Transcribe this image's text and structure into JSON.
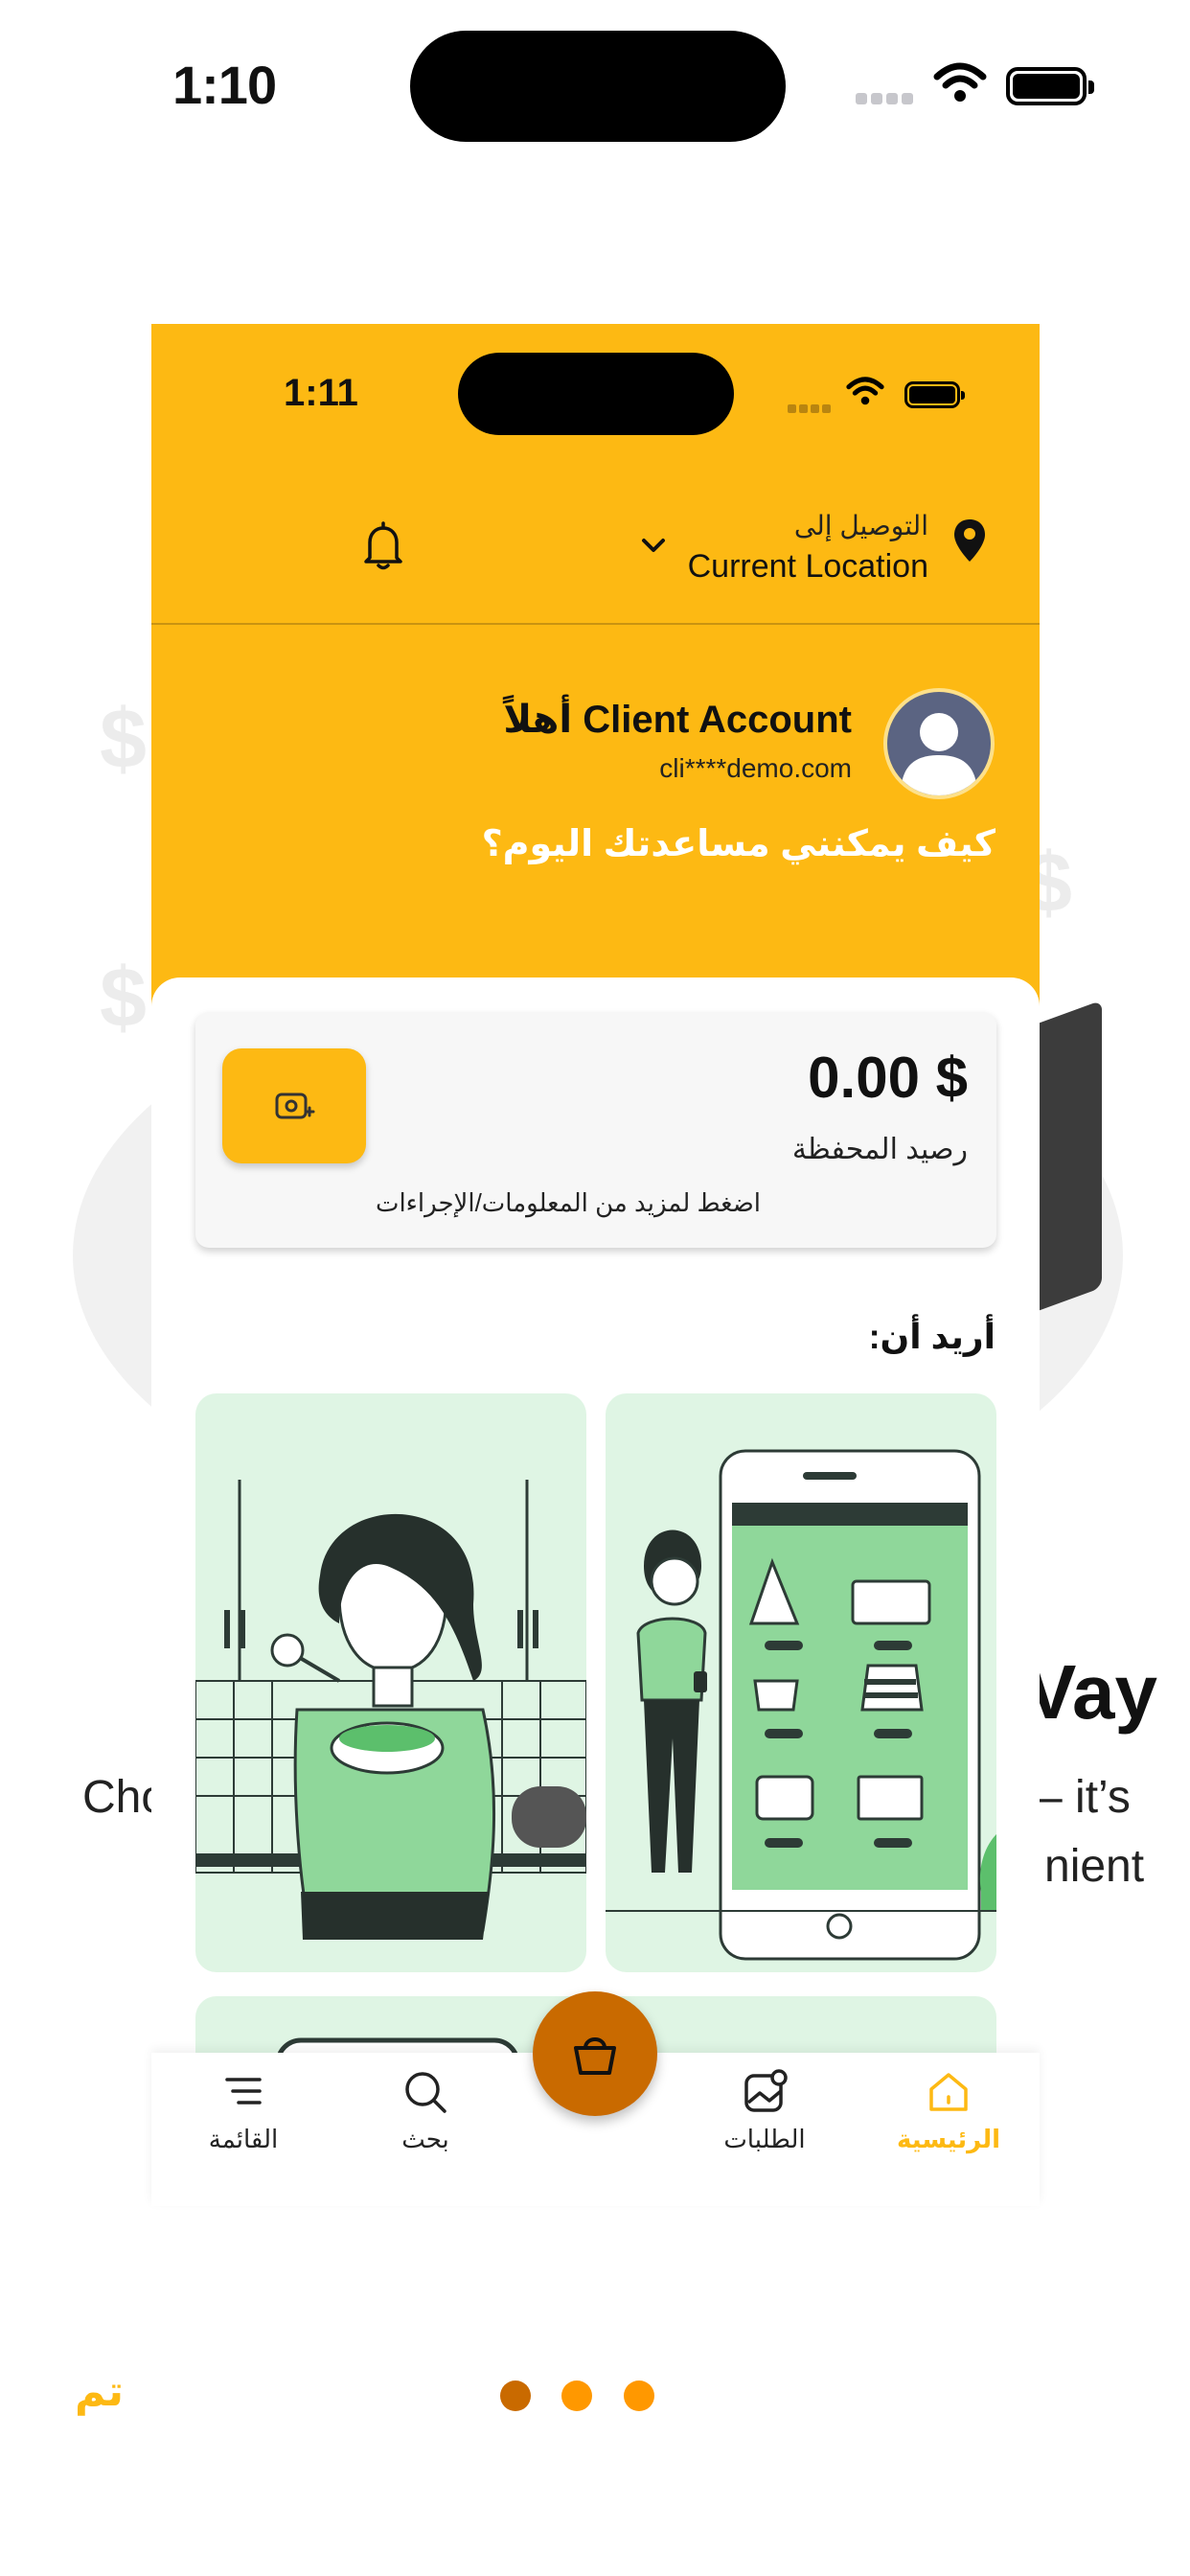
{
  "outer_status": {
    "time": "1:10"
  },
  "inner_status": {
    "time": "1:11"
  },
  "header": {
    "deliver_to_label": "التوصيل إلى",
    "location": "Current Location"
  },
  "profile": {
    "greeting": "أهلاً Client Account",
    "email": "cli****demo.com",
    "help_text": "كيف يمكنني مساعدتك اليوم؟"
  },
  "wallet": {
    "amount": "0.00 $",
    "label": "رصيد المحفظة",
    "more_info": "اضغط لمزيد من المعلومات/الإجراءات"
  },
  "section": {
    "want_title": "أريد أن:"
  },
  "tabs": [
    {
      "label": "الرئيسية",
      "icon": "home-icon",
      "active": true
    },
    {
      "label": "الطلبات",
      "icon": "orders-icon",
      "active": false
    },
    {
      "label": "بحث",
      "icon": "search-icon",
      "active": false
    },
    {
      "label": "القائمة",
      "icon": "menu-icon",
      "active": false
    }
  ],
  "background_text": {
    "title_fragment": "Vay",
    "left_fragment": "Cho",
    "right_fragment_1": "– it’s",
    "right_fragment_2": "nient"
  },
  "onboarding": {
    "done_label": "تم",
    "page_dots": [
      "#C96A00",
      "#FF9800",
      "#FF9800"
    ]
  },
  "colors": {
    "brand_yellow": "#FDB913",
    "fab_orange": "#C96A00",
    "card_green": "#dff5e4"
  }
}
